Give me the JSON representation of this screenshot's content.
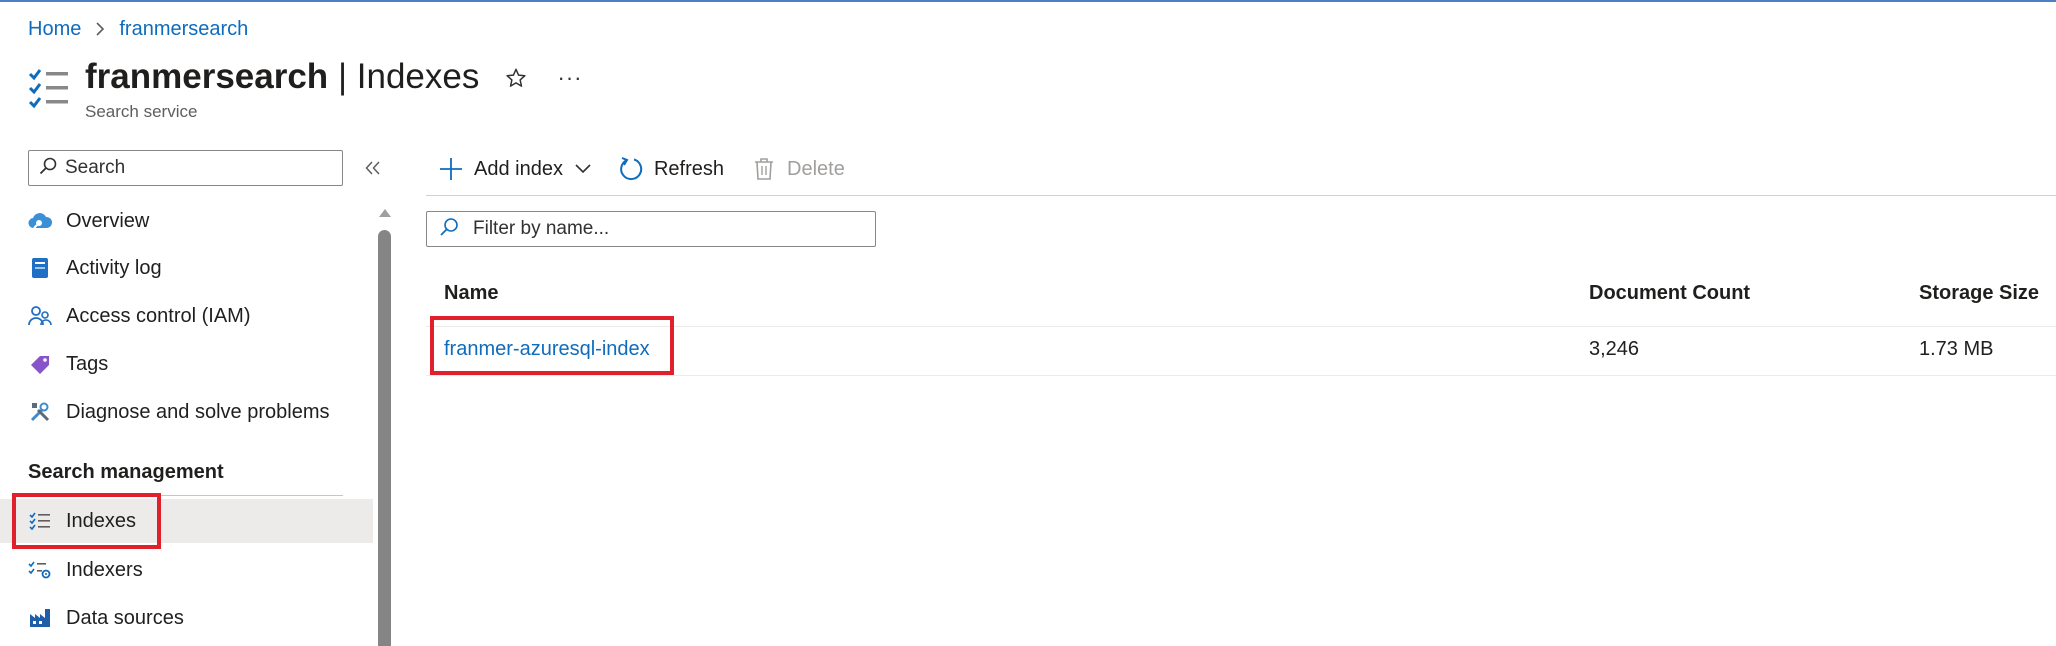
{
  "breadcrumb": {
    "home": "Home",
    "current": "franmersearch"
  },
  "header": {
    "service_name": "franmersearch",
    "separator": "|",
    "page_title": "Indexes",
    "subtitle": "Search service",
    "more_label": "···"
  },
  "sidebar": {
    "search_placeholder": "Search",
    "items_top": [
      {
        "label": "Overview",
        "icon": "cloud-search-icon"
      },
      {
        "label": "Activity log",
        "icon": "activity-log-icon"
      },
      {
        "label": "Access control (IAM)",
        "icon": "people-icon"
      },
      {
        "label": "Tags",
        "icon": "tag-icon"
      },
      {
        "label": "Diagnose and solve problems",
        "icon": "wrench-icon"
      }
    ],
    "section_title": "Search management",
    "items_section": [
      {
        "label": "Indexes",
        "icon": "index-list-icon",
        "active": true
      },
      {
        "label": "Indexers",
        "icon": "indexer-icon"
      },
      {
        "label": "Data sources",
        "icon": "factory-icon"
      }
    ]
  },
  "toolbar": {
    "add_index": "Add index",
    "refresh": "Refresh",
    "delete": "Delete"
  },
  "filter": {
    "placeholder": "Filter by name..."
  },
  "table": {
    "columns": [
      "Name",
      "Document Count",
      "Storage Size"
    ],
    "rows": [
      {
        "name": "franmer-azuresql-index",
        "document_count": "3,246",
        "storage_size": "1.73 MB"
      }
    ]
  },
  "colors": {
    "accent": "#0f6cbd",
    "highlight": "#e0202b"
  }
}
